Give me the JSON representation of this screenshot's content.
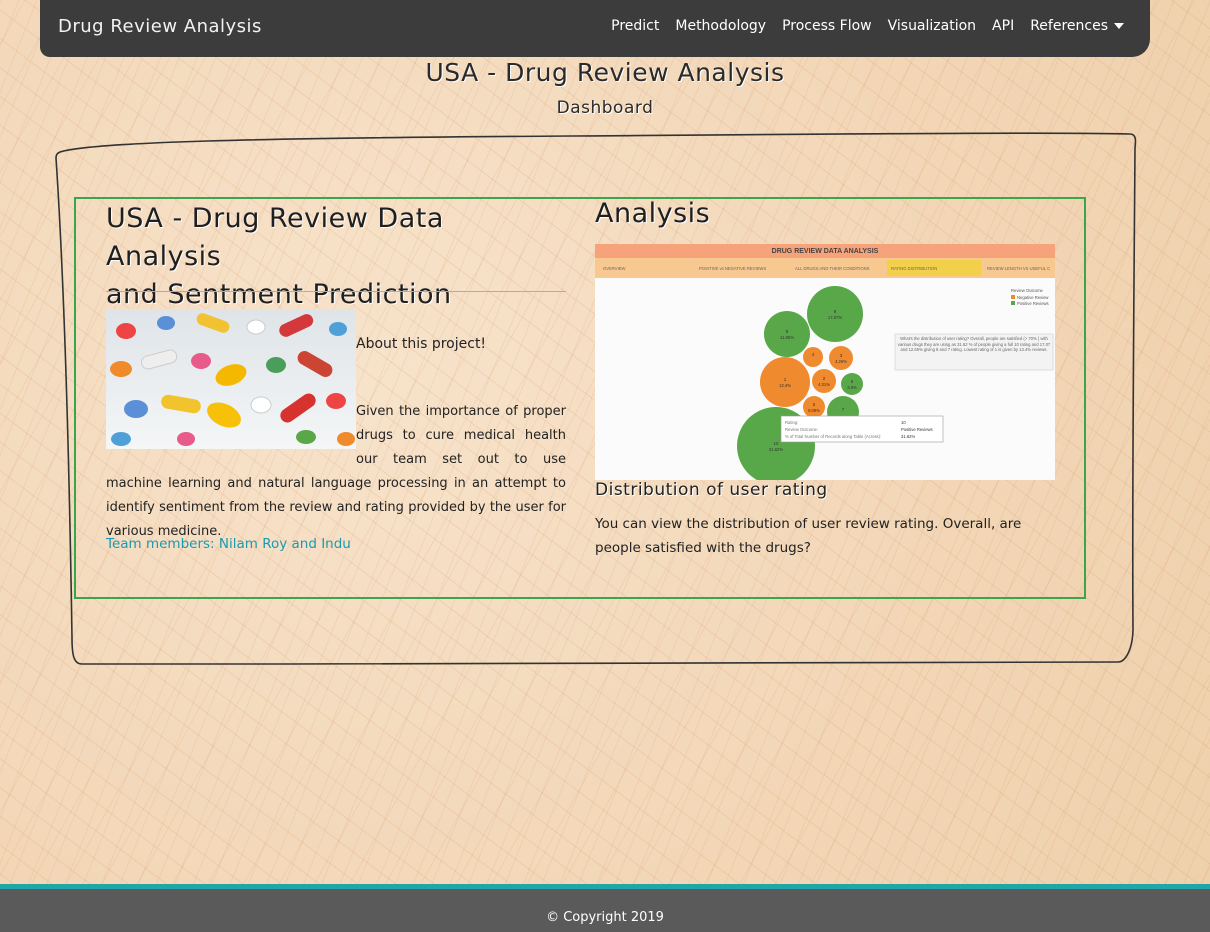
{
  "navbar": {
    "brand": "Drug Review Analysis",
    "links": [
      "Predict",
      "Methodology",
      "Process Flow",
      "Visualization",
      "API",
      "References"
    ]
  },
  "header": {
    "title": "USA - Drug Review Analysis",
    "subtitle": "Dashboard"
  },
  "project": {
    "title_line1": "USA - Drug Review Data Analysis",
    "title_line2": "and Sentment Prediction",
    "about_label": "About this project!",
    "description": "Given the importance of proper drugs to cure medical health our team set out to use machine learning and natural language processing in an attempt to identify sentiment from the review and rating provided by the user for various medicine.",
    "team_link": "Team members: Nilam Roy and Indu"
  },
  "analysis": {
    "title": "Analysis",
    "dashboard": {
      "title": "DRUG REVIEW DATA ANALYSIS",
      "tabs": [
        "OVERVIEW",
        "POSITIVE vs NEGATIVE REVIEWS",
        "ALL DRUGS AND THEIR CONDITIONS",
        "RATING DISTRIBUTION",
        "REVIEW LENGTH VS USEFUL C"
      ],
      "active_tab": 3,
      "legend_title": "Review Outcome",
      "legend": [
        {
          "label": "Negative Review",
          "color": "#ef8a2e"
        },
        {
          "label": "Positive Reviews",
          "color": "#58a849"
        }
      ],
      "annotation": "What's the distribution of user rating? Overall, people are satisfied (> 70% ) with various drugs they are using as 31.62 % of people giving a full 10 rating and 17.07 and 12.65% giving 8 and 7 rating. Lowest rating of 1 is given by 13.4% reviews.",
      "bubbles": [
        {
          "label": "8",
          "pct": "17.07%",
          "color": "#58a849"
        },
        {
          "label": "9",
          "pct": "11.95%",
          "color": "#58a849"
        },
        {
          "label": "4",
          "pct": "",
          "color": "#ef8a2e"
        },
        {
          "label": "3",
          "pct": "4.26%",
          "color": "#ef8a2e"
        },
        {
          "label": "1",
          "pct": "13.4%",
          "color": "#ef8a2e"
        },
        {
          "label": "2",
          "pct": "4.31%",
          "color": "#ef8a2e"
        },
        {
          "label": "6",
          "pct": "3.9%",
          "color": "#58a849"
        },
        {
          "label": "5",
          "pct": "5.09%",
          "color": "#ef8a2e"
        },
        {
          "label": "7",
          "pct": "",
          "color": "#58a849"
        },
        {
          "label": "10",
          "pct": "31.62%",
          "color": "#58a849"
        }
      ],
      "tooltip": {
        "rows": [
          {
            "k": "Rating:",
            "v": "10"
          },
          {
            "k": "Review Outcome:",
            "v": "Positive Reviews"
          },
          {
            "k": "% of Total Number of Records along Table (Across):",
            "v": "31.62%"
          }
        ]
      }
    },
    "dist_title": "Distribution of user rating",
    "dist_desc": "You can view the distribution of user review rating. Overall, are people satisfied with the drugs?"
  },
  "footer": {
    "copyright": "© Copyright 2019"
  },
  "colors": {
    "navbar_bg": "#3c3c3c",
    "card_border": "#3aa64c",
    "link": "#1a9ab0",
    "footer_bg": "#5a5a5a",
    "footer_accent": "#20a6a6"
  }
}
